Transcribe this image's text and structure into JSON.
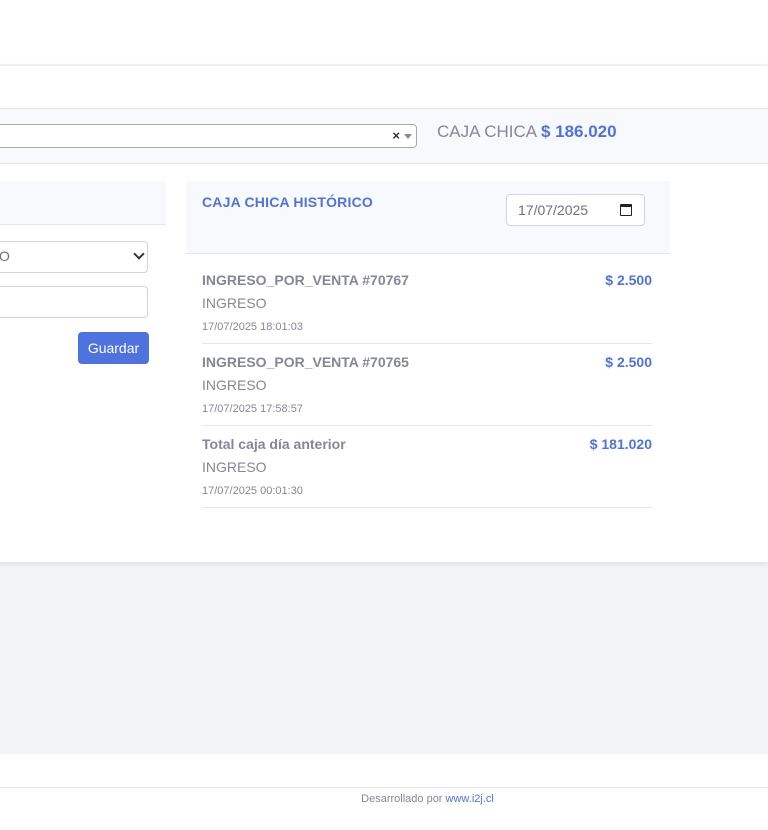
{
  "header": {
    "caja_label": "CAJA CHICA",
    "caja_amount": "$ 186.020",
    "select_clear": "×"
  },
  "form": {
    "type_select_value": "O",
    "amount_input_value": "",
    "save_label": "Guardar"
  },
  "history": {
    "title": "CAJA CHICA HISTÓRICO",
    "date_value": "17/07/2025",
    "items": [
      {
        "name": "INGRESO_POR_VENTA #70767",
        "amount": "$ 2.500",
        "type": "INGRESO",
        "timestamp": "17/07/2025 18:01:03"
      },
      {
        "name": "INGRESO_POR_VENTA #70765",
        "amount": "$ 2.500",
        "type": "INGRESO",
        "timestamp": "17/07/2025 17:58:57"
      },
      {
        "name": "Total caja día anterior",
        "amount": "$ 181.020",
        "type": "INGRESO",
        "timestamp": "17/07/2025 00:01:30"
      }
    ]
  },
  "footer": {
    "text": "Desarrollado por",
    "link": "www.i2j.cl"
  },
  "colors": {
    "accent": "#4e73df",
    "text_muted": "#858796",
    "background": "#f3f4f7"
  }
}
